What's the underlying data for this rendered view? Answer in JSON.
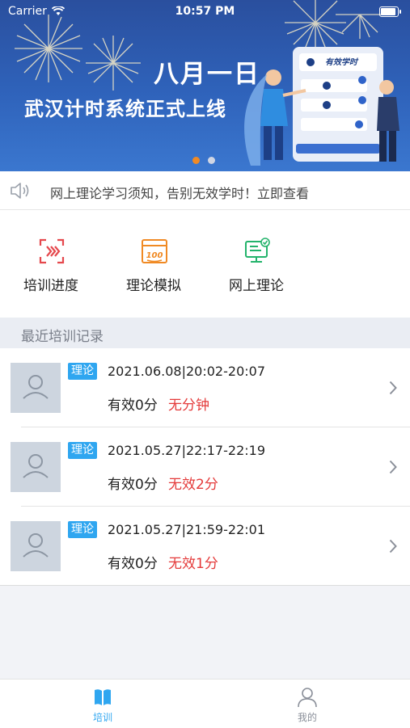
{
  "status_bar": {
    "carrier": "Carrier",
    "time": "10:57 PM"
  },
  "banner": {
    "title": "八月一日",
    "subtitle": "武汉计时系统正式上线",
    "badge": "有效学时",
    "page_count": 2,
    "active_page": 1
  },
  "notice": {
    "text": "网上理论学习须知，告别无效学时！立即查看"
  },
  "menu": {
    "items": [
      {
        "label": "培训进度",
        "icon": "training-progress-icon"
      },
      {
        "label": "理论模拟",
        "icon": "theory-simulation-icon"
      },
      {
        "label": "网上理论",
        "icon": "online-theory-icon"
      }
    ]
  },
  "records": {
    "title": "最近培训记录",
    "items": [
      {
        "tag": "理论",
        "time": "2021.06.08|20:02-20:07",
        "effective": "有效0分",
        "invalid": "无分钟"
      },
      {
        "tag": "理论",
        "time": "2021.05.27|22:17-22:19",
        "effective": "有效0分",
        "invalid": "无效2分"
      },
      {
        "tag": "理论",
        "time": "2021.05.27|21:59-22:01",
        "effective": "有效0分",
        "invalid": "无效1分"
      }
    ]
  },
  "tabbar": {
    "tabs": [
      {
        "label": "培训",
        "active": true
      },
      {
        "label": "我的",
        "active": false
      }
    ]
  },
  "colors": {
    "accent": "#2fa6f0",
    "danger": "#e43a3a",
    "dot_active": "#f08a24"
  }
}
